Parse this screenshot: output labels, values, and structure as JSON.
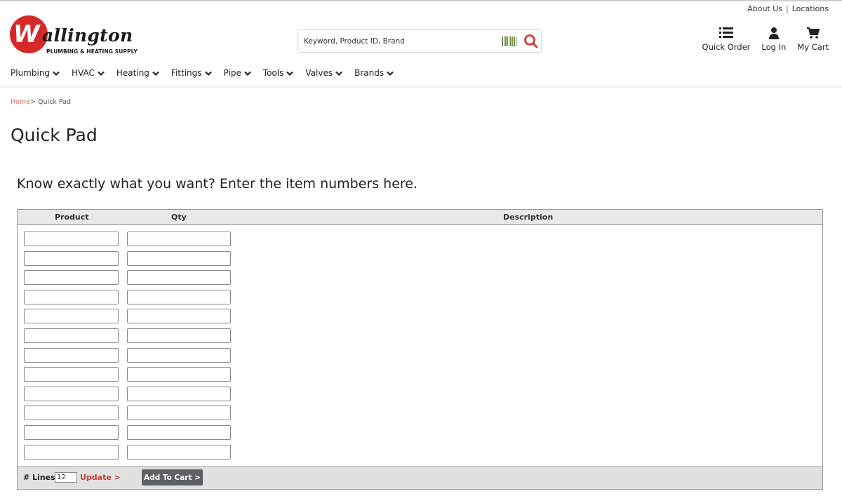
{
  "util_links": {
    "about": "About Us",
    "separator": "|",
    "locations": "Locations"
  },
  "logo": {
    "letter": "W",
    "name": "allington",
    "tagline": "PLUMBING & HEATING SUPPLY"
  },
  "search": {
    "placeholder": "Keyword, Product ID, Brand"
  },
  "header_actions": [
    {
      "label": "Quick Order",
      "icon": "list-icon"
    },
    {
      "label": "Log In",
      "icon": "user-icon"
    },
    {
      "label": "My Cart",
      "icon": "cart-icon"
    }
  ],
  "nav": [
    "Plumbing",
    "HVAC",
    "Heating",
    "Fittings",
    "Pipe",
    "Tools",
    "Valves",
    "Brands"
  ],
  "breadcrumb": {
    "home": "Home",
    "current": "> Quick Pad"
  },
  "page_title": "Quick Pad",
  "intro": "Know exactly what you want? Enter the item numbers here.",
  "table": {
    "columns": [
      "Product",
      "Qty",
      "Description"
    ],
    "row_count": 12
  },
  "footer": {
    "lines_label": "# Lines",
    "lines_value": "12",
    "update": "Update >",
    "add_to_cart": "Add To Cart >"
  },
  "colors": {
    "brand_red": "#d62829",
    "button_gray": "#5d6166",
    "link_red": "#d23b3b"
  }
}
